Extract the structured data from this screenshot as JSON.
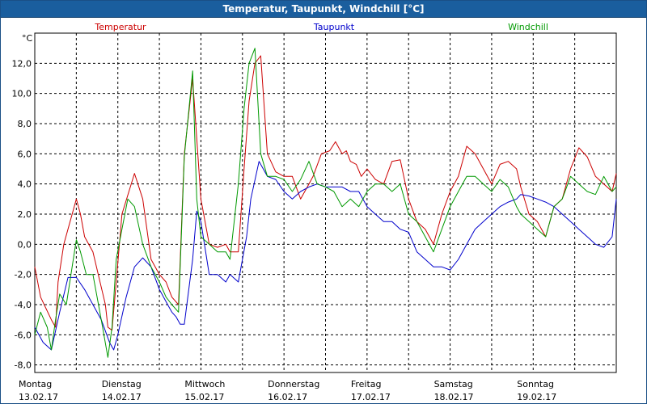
{
  "window": {
    "title": "Temperatur, Taupunkt, Windchill [°C]"
  },
  "chart_data": {
    "type": "line",
    "title": "Temperatur, Taupunkt, Windchill [°C]",
    "ylabel": "°C",
    "ylim": [
      -8.5,
      14.0
    ],
    "xlim": [
      0,
      7
    ],
    "grid": true,
    "legend_position": "top",
    "y_ticks": [
      -8,
      -6,
      -4,
      -2,
      0,
      2,
      4,
      6,
      8,
      10,
      12
    ],
    "y_tick_labels": [
      "-8,0",
      "-6,0",
      "-4,0",
      "-2,0",
      "0,0",
      "2,0",
      "4,0",
      "6,0",
      "8,0",
      "10,0",
      "12,0"
    ],
    "x_ticks": [
      {
        "day": "Montag",
        "date": "13.02.17"
      },
      {
        "day": "Dienstag",
        "date": "14.02.17"
      },
      {
        "day": "Mittwoch",
        "date": "15.02.17"
      },
      {
        "day": "Donnerstag",
        "date": "16.02.17"
      },
      {
        "day": "Freitag",
        "date": "17.02.17"
      },
      {
        "day": "Samstag",
        "date": "18.02.17"
      },
      {
        "day": "Sonntag",
        "date": "19.02.17"
      }
    ],
    "series": [
      {
        "name": "Temperatur",
        "color": "#cc0000",
        "x": [
          0,
          0.07,
          0.2,
          0.25,
          0.28,
          0.35,
          0.5,
          0.55,
          0.6,
          0.7,
          0.85,
          0.88,
          0.93,
          0.98,
          1.05,
          1.2,
          1.3,
          1.4,
          1.5,
          1.58,
          1.65,
          1.73,
          1.8,
          1.9,
          2.0,
          2.1,
          2.2,
          2.3,
          2.35,
          2.45,
          2.52,
          2.58,
          2.65,
          2.72,
          2.8,
          2.9,
          3.0,
          3.1,
          3.2,
          3.3,
          3.35,
          3.45,
          3.55,
          3.62,
          3.7,
          3.75,
          3.8,
          3.87,
          3.93,
          4.0,
          4.1,
          4.2,
          4.3,
          4.4,
          4.5,
          4.6,
          4.7,
          4.8,
          4.9,
          5.0,
          5.1,
          5.2,
          5.3,
          5.5,
          5.6,
          5.7,
          5.8,
          5.85,
          5.95,
          6.05,
          6.15,
          6.25,
          6.35,
          6.45,
          6.55,
          6.65,
          6.75,
          6.85,
          6.95,
          7.0
        ],
        "values": [
          -1.5,
          -3.5,
          -5.0,
          -5.5,
          -2.5,
          0.0,
          3.0,
          2.0,
          0.5,
          -0.5,
          -4.0,
          -5.5,
          -5.7,
          -2.5,
          2.0,
          4.7,
          3.0,
          -1.0,
          -2.0,
          -2.5,
          -3.5,
          -4.0,
          6.0,
          11.0,
          3.0,
          0.0,
          -0.2,
          0.0,
          -0.5,
          -0.5,
          5.0,
          9.5,
          12.0,
          12.5,
          6.0,
          4.8,
          4.5,
          4.5,
          3.0,
          4.0,
          4.5,
          6.0,
          6.2,
          6.8,
          6.0,
          6.2,
          5.5,
          5.3,
          4.5,
          5.0,
          4.3,
          4.0,
          5.5,
          5.6,
          3.0,
          1.5,
          1.0,
          0.0,
          2.0,
          3.5,
          4.5,
          6.5,
          6.0,
          4.0,
          5.3,
          5.5,
          5.0,
          3.8,
          2.0,
          1.5,
          0.5,
          2.5,
          3.0,
          5.0,
          6.4,
          5.8,
          4.5,
          4.0,
          3.5,
          4.7
        ]
      },
      {
        "name": "Taupunkt",
        "color": "#0000cc",
        "x": [
          0,
          0.1,
          0.2,
          0.3,
          0.4,
          0.5,
          0.6,
          0.7,
          0.8,
          0.9,
          0.95,
          1.0,
          1.1,
          1.2,
          1.3,
          1.4,
          1.5,
          1.6,
          1.65,
          1.7,
          1.75,
          1.8,
          1.9,
          1.95,
          2.0,
          2.1,
          2.2,
          2.3,
          2.35,
          2.45,
          2.55,
          2.6,
          2.7,
          2.75,
          2.8,
          2.9,
          3.0,
          3.1,
          3.2,
          3.3,
          3.4,
          3.5,
          3.6,
          3.7,
          3.8,
          3.9,
          4.0,
          4.1,
          4.2,
          4.3,
          4.4,
          4.5,
          4.6,
          4.7,
          4.8,
          4.9,
          5.0,
          5.1,
          5.2,
          5.3,
          5.4,
          5.5,
          5.6,
          5.7,
          5.8,
          5.85,
          5.95,
          6.05,
          6.15,
          6.25,
          6.35,
          6.45,
          6.55,
          6.65,
          6.75,
          6.85,
          6.95,
          7.0
        ],
        "values": [
          -5.5,
          -6.5,
          -7.0,
          -4.5,
          -2.2,
          -2.2,
          -3.0,
          -4.0,
          -5.0,
          -6.5,
          -7.0,
          -6.0,
          -3.5,
          -1.5,
          -0.9,
          -1.5,
          -3.0,
          -4.0,
          -4.5,
          -4.8,
          -5.3,
          -5.3,
          -1.0,
          2.2,
          1.5,
          -2.0,
          -2.0,
          -2.5,
          -2.0,
          -2.5,
          0.5,
          3.0,
          5.5,
          5.0,
          4.5,
          4.3,
          3.5,
          3.0,
          3.5,
          3.8,
          4.0,
          3.8,
          3.8,
          3.8,
          3.5,
          3.5,
          2.5,
          2.0,
          1.5,
          1.5,
          1.0,
          0.8,
          -0.5,
          -1.0,
          -1.5,
          -1.5,
          -1.7,
          -1.0,
          0.0,
          1.0,
          1.5,
          2.0,
          2.5,
          2.8,
          3.0,
          3.3,
          3.2,
          3.0,
          2.8,
          2.5,
          2.0,
          1.5,
          1.0,
          0.5,
          0.0,
          -0.2,
          0.5,
          3.0
        ]
      },
      {
        "name": "Windchill",
        "color": "#009900",
        "x": [
          0,
          0.07,
          0.15,
          0.2,
          0.25,
          0.3,
          0.38,
          0.45,
          0.5,
          0.55,
          0.62,
          0.7,
          0.8,
          0.88,
          0.93,
          0.98,
          1.05,
          1.12,
          1.2,
          1.3,
          1.4,
          1.5,
          1.58,
          1.65,
          1.73,
          1.8,
          1.9,
          1.95,
          2.0,
          2.1,
          2.2,
          2.3,
          2.35,
          2.45,
          2.52,
          2.58,
          2.65,
          2.72,
          2.8,
          2.9,
          3.0,
          3.1,
          3.2,
          3.3,
          3.4,
          3.5,
          3.6,
          3.7,
          3.8,
          3.9,
          4.0,
          4.1,
          4.2,
          4.3,
          4.4,
          4.5,
          4.6,
          4.7,
          4.8,
          4.9,
          5.0,
          5.1,
          5.2,
          5.3,
          5.4,
          5.5,
          5.6,
          5.7,
          5.8,
          5.85,
          5.95,
          6.05,
          6.15,
          6.25,
          6.35,
          6.45,
          6.55,
          6.65,
          6.75,
          6.85,
          6.95,
          7.0
        ],
        "values": [
          -6.0,
          -4.5,
          -5.5,
          -7.0,
          -5.0,
          -3.3,
          -4.0,
          -1.5,
          0.3,
          -0.5,
          -2.0,
          -2.0,
          -5.0,
          -7.5,
          -5.5,
          -1.0,
          1.0,
          3.0,
          2.5,
          0.0,
          -1.5,
          -2.5,
          -3.5,
          -4.0,
          -4.5,
          5.8,
          11.5,
          3.0,
          0.5,
          0.0,
          -0.5,
          -0.5,
          -1.0,
          4.0,
          9.0,
          12.0,
          13.0,
          6.0,
          4.5,
          4.5,
          4.3,
          3.5,
          4.3,
          5.5,
          4.0,
          3.8,
          3.5,
          2.5,
          3.0,
          2.5,
          3.5,
          4.0,
          4.0,
          3.5,
          4.0,
          2.0,
          1.5,
          0.5,
          -0.5,
          1.0,
          2.5,
          3.5,
          4.5,
          4.5,
          4.0,
          3.5,
          4.3,
          3.8,
          2.5,
          2.0,
          1.5,
          1.0,
          0.5,
          2.5,
          3.0,
          4.5,
          4.0,
          3.5,
          3.3,
          4.5,
          3.5,
          3.8
        ]
      }
    ]
  }
}
